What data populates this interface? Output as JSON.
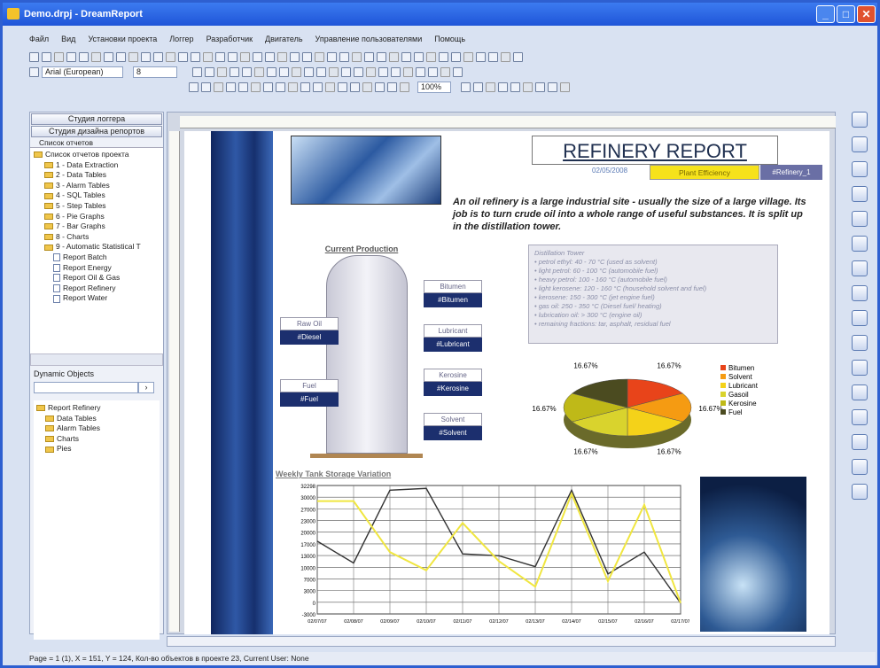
{
  "window": {
    "title": "Demo.drpj - DreamReport",
    "min": "_",
    "max": "□",
    "close": "✕"
  },
  "menu": [
    "Файл",
    "Вид",
    "Установки проекта",
    "Логгер",
    "Разработчик",
    "Двигатель",
    "Управление пользователями",
    "Помощь"
  ],
  "toolbar": {
    "font": "Arial (European)",
    "size": "8",
    "zoom": "100%"
  },
  "left": {
    "btn1": "Студия логгера",
    "btn2": "Студия дизайна репортов",
    "tree_title": "Список отчетов",
    "tree": [
      "Список отчетов проекта",
      "1 - Data Extraction",
      "2 - Data Tables",
      "3 - Alarm Tables",
      "4 - SQL Tables",
      "5 - Step Tables",
      "6 - Pie Graphs",
      "7 - Bar Graphs",
      "8 - Charts",
      "9 - Automatic Statistical T",
      "Report Batch",
      "Report Energy",
      "Report Oil & Gas",
      "Report Refinery",
      "Report Water"
    ],
    "dyn_title": "Dynamic Objects",
    "dyn_tree": [
      "Report Refinery",
      "Data Tables",
      "Alarm Tables",
      "Charts",
      "Pies"
    ]
  },
  "report": {
    "title": "REFINERY REPORT",
    "date": "02/05/2008",
    "yellow_label": "Plant Efficiency",
    "tag": "#Refinery_1",
    "intro": "An oil refinery is a large industrial site - usually the size of a large village. Its job is to turn crude oil into a whole range of useful substances. It is split up in the distillation tower.",
    "column_title": "Current Production",
    "left_labels": [
      {
        "title": "Raw Oil",
        "value": "#Diesel"
      },
      {
        "title": "Fuel",
        "value": "#Fuel"
      }
    ],
    "right_labels": [
      {
        "title": "Bitumen",
        "value": "#Bitumen"
      },
      {
        "title": "Lubricant",
        "value": "#Lubricant"
      },
      {
        "title": "Kerosine",
        "value": "#Kerosine"
      },
      {
        "title": "Solvent",
        "value": "#Solvent"
      }
    ],
    "tower_title": "Distillation Tower",
    "tower_lines": [
      "• petrol ethyl: 40 - 70 °C (used as solvent)",
      "• light petrol: 60 - 100 °C (automobile fuel)",
      "• heavy petrol: 100 - 160 °C (automobile fuel)",
      "• light kerosene: 120 - 160 °C (household solvent and fuel)",
      "• kerosene: 150 - 300 °C (jet engine fuel)",
      "• gas oil: 250 - 350 °C (Diesel fuel/ heating)",
      "• lubrication oil: > 300 °C (engine oil)",
      "• remaining fractions: tar, asphalt, residual fuel"
    ],
    "line_title": "Weekly Tank Storage Variation"
  },
  "chart_data": [
    {
      "type": "pie",
      "values": [
        16.67,
        16.67,
        16.67,
        16.67,
        16.67,
        16.67
      ],
      "labels": [
        "16.67%",
        "16.67%",
        "16.67%",
        "16.67%",
        "16.67%",
        "16.67%"
      ],
      "legend": [
        "Bitumen",
        "Solvent",
        "Lubricant",
        "Gasoil",
        "Kerosine",
        "Fuel"
      ],
      "colors": [
        "#e8441a",
        "#f59b12",
        "#f4d219",
        "#d9d32d",
        "#bfb918",
        "#4b4b20"
      ]
    },
    {
      "type": "line",
      "title": "Weekly Tank Storage Variation",
      "yticks": [
        "32298",
        "30000",
        "27000",
        "23000",
        "20000",
        "17000",
        "13000",
        "10000",
        "7000",
        "3000",
        "0",
        "-3000"
      ],
      "x": [
        "02/07/07",
        "02/08/07",
        "02/09/07",
        "02/10/07",
        "02/11/07",
        "02/12/07",
        "02/13/07",
        "02/14/07",
        "02/15/07",
        "02/16/07",
        "02/17/07"
      ],
      "series": [
        {
          "values": [
            17000,
            11000,
            31000,
            31500,
            13500,
            13000,
            10000,
            31000,
            8000,
            14000,
            0
          ]
        },
        {
          "values": [
            28000,
            28000,
            14000,
            9000,
            22000,
            11500,
            4500,
            30000,
            6000,
            27000,
            0
          ]
        }
      ],
      "colors": [
        "#333333",
        "#f0e640"
      ]
    }
  ],
  "statusbar": "Page = 1 (1), X = 151, Y = 124, Кол-во объектов в проекте 23, Current User: None"
}
